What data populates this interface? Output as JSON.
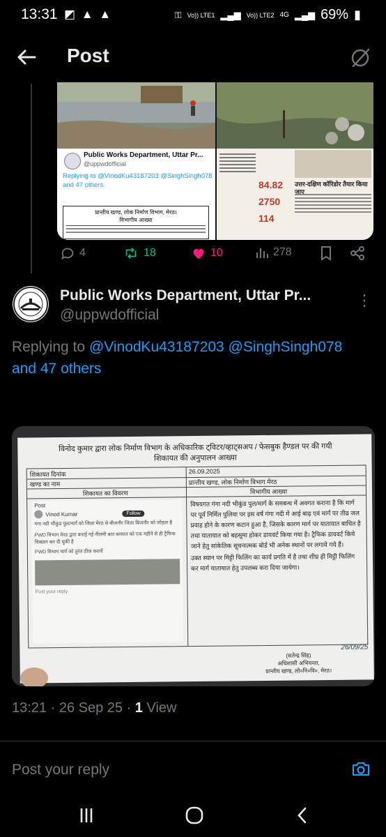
{
  "status_bar": {
    "time": "13:31",
    "left_icons": "◩ ▲ ▲",
    "network_label_1": "Vo)) LTE1",
    "network_label_2": "Vo)) LTE2",
    "data_label": "4G",
    "battery": "69%"
  },
  "header": {
    "title": "Post"
  },
  "previous_tweet": {
    "embedded_name": "Public Works Department, Uttar Pr...",
    "embedded_handle": "@uppwdofficial",
    "embedded_reply": "Replying to @VinodKu43187203 @SinghSingh078 and 47 others",
    "embedded_doc_heading": "प्रान्तीय खण्ड, लोक निर्माण विभाग, मेरठ।",
    "embedded_doc_sub": "विभागीय आख्या",
    "news_numbers": [
      "84.82",
      "2750",
      "114"
    ],
    "news_headline": "उत्तर-दक्षिण कॉरिडोर तैयार किया जाए",
    "replies": "4",
    "reposts": "18",
    "likes": "10",
    "views": "278"
  },
  "tweet": {
    "name": "Public Works Department, Uttar Pr...",
    "handle": "@uppwdofficial",
    "replying_prefix": "Replying to ",
    "mention_1": "@VinodKu43187203",
    "mention_2": "@SinghSingh078",
    "mention_3": "and 47 others",
    "timestamp": "13:21 · 26 Sep 25 · ",
    "views_count": "1",
    "views_label": " View"
  },
  "document": {
    "heading_line_1": "विनोद कुमार द्वारा लोक निर्माण विभाग के अधिकारिक ट्विटर/व्हाट्सअप / फेसबुक हैण्डल पर की गयी",
    "heading_line_2": "शिकायत की अनुपालन आख्या",
    "label_date": "शिकायत दिनांक",
    "value_date": "26.09.2025",
    "label_division": "खण्ड का नाम",
    "value_division": "प्रान्तीय खण्ड, लोक निर्माण विभाग मेरठ",
    "col_complaint": "शिकायत का विवरण",
    "col_report": "विभागीय आख्या",
    "report_text_1": "विषयगत गंगा नदी भीकुंड पुल/मार्ग के समबन्ध में अवगत कराना है कि मार्ग पर पूर्व निर्मित पुलिया पर इस वर्ष गंगा नदी में आई बाढ़ एवं मार्ग पर तीव्र जल प्रवाह होने के कारण कटान हुआ है, जिसके कारण मार्ग पर यातायात बाधित है तथा यातायात को बहसूमा होकर डायवर्ट किया गया है। ट्रैफिक डायवर्ट किये जाने हेतु सांकेतिक सूचनात्मक बोर्ड भी अनेक स्थानों पर लगाये गये हैं।",
    "report_text_2": "उक्त स्थान पर मिट्टी फिलिंग का कार्य प्रगति में है तथा शीघ्र ही मिट्टी फिलिंग कर मार्ग यातायात हेतु उपलब्ध करा दिया जायेगा।",
    "phone_title": "Post",
    "phone_user": "Vinod Kumar",
    "phone_follow": "Follow",
    "phone_text_1": "गंगा नदी भीकुंड पुल/मार्ग को जिला मेरठ से बीजनौर जिला बिजनौर को जोड़ता है",
    "phone_text_2": "PWD विभाग मेरठ द्वारा बनाई गई नीलमी बात बरसात को एक महीने से ही ट्रैफिक विखंडन कर दी चुकी है",
    "phone_text_3": "PWD विभाग मार्ग को तुरंत ठीक करायें",
    "phone_reply": "Post your reply",
    "signature": "26/09/25",
    "sign_line_1": "(सतेन्द्र सिंह)",
    "sign_line_2": "अधिशासी अभियन्ता,",
    "sign_line_3": "प्रान्तीय खण्ड, लो०नि०वि०, मेरठ।"
  },
  "reply_box": {
    "placeholder": "Post your reply"
  },
  "icons": {
    "back": "arrow-left-icon",
    "ghost": "grok-icon",
    "camera": "camera-icon",
    "more": "more-icon"
  },
  "colors": {
    "background": "#000000",
    "accent": "#1d9bf0",
    "like": "#f91880",
    "repost": "#00ba7c",
    "muted": "#71767b"
  }
}
